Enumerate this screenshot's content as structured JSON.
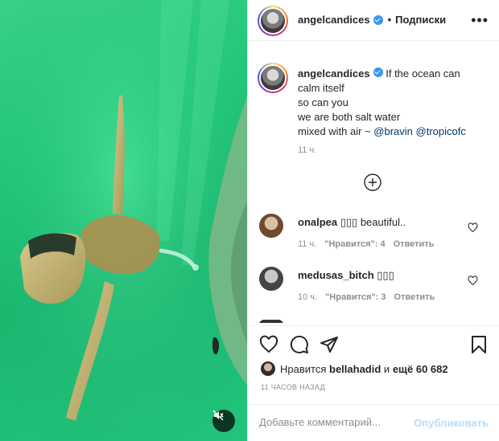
{
  "post": {
    "username": "angelcandices",
    "follow_state": "Подписки",
    "header_separator": "•",
    "more_glyph": "•••",
    "caption_lines": [
      "If the ocean can",
      "calm itself",
      "so can you",
      "we are both salt water",
      "mixed with air ~ "
    ],
    "caption_mentions": [
      "@bravin",
      "@tropicofc"
    ],
    "caption_time": "11 ч."
  },
  "comments": [
    {
      "username": "onalpea",
      "text": "▯▯▯ beautiful..",
      "time": "11 ч.",
      "likes": "\"Нравится\": 4",
      "reply": "Ответить"
    },
    {
      "username": "medusas_bitch",
      "text": "▯▯▯",
      "time": "10 ч.",
      "likes": "\"Нравится\": 3",
      "reply": "Ответить"
    }
  ],
  "likes": {
    "prefix": "Нравится",
    "liked_by": "bellahadid",
    "connector": "и",
    "others": "ещё 60 682"
  },
  "post_time": "11 часов назад",
  "add_comment": {
    "placeholder": "Добавьте комментарий...",
    "publish_label": "Опубликовать"
  },
  "colors": {
    "accent_blue": "#3897f0",
    "publish_disabled": "#b2dffc",
    "water_green": "#20c878"
  },
  "icons": [
    "verified-badge-icon",
    "more-icon",
    "add-circle-icon",
    "heart-icon",
    "comment-icon",
    "share-icon",
    "bookmark-icon",
    "mute-icon"
  ]
}
